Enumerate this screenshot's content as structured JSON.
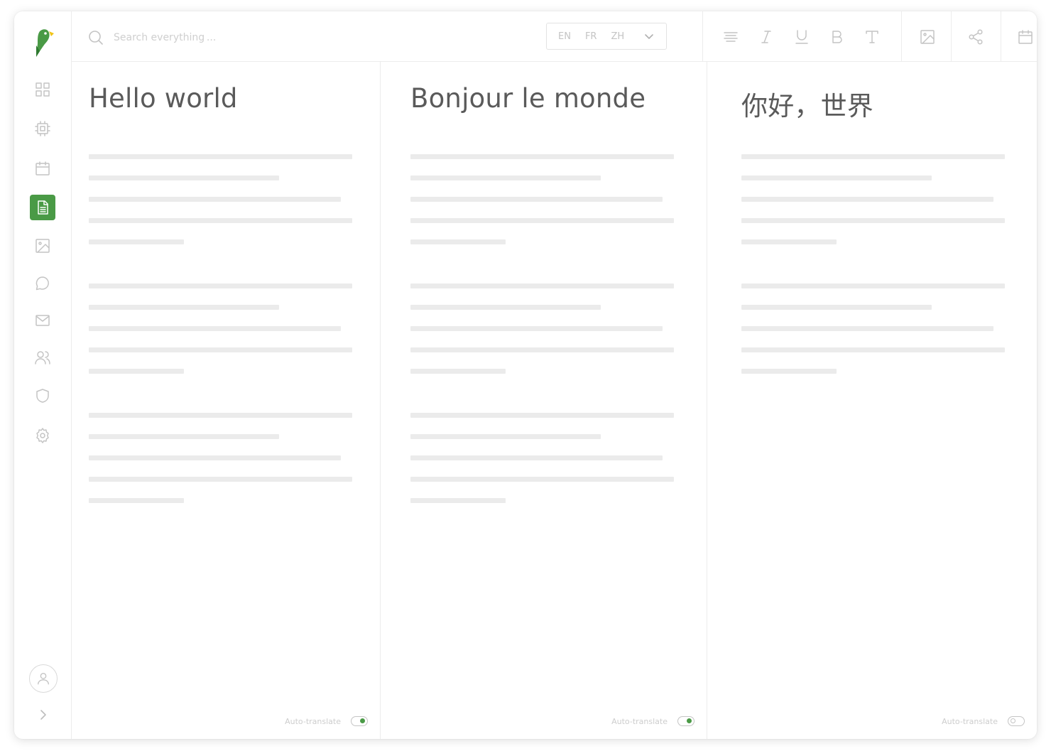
{
  "app": {
    "brand_colors": {
      "primary": "#4a9a46",
      "accent": "#f0c419"
    }
  },
  "sidebar": {
    "items": [
      {
        "name": "dashboard-grid-icon",
        "active": false
      },
      {
        "name": "chip-icon",
        "active": false
      },
      {
        "name": "calendar-icon",
        "active": false
      },
      {
        "name": "document-icon",
        "active": true
      },
      {
        "name": "image-icon",
        "active": false
      },
      {
        "name": "chat-icon",
        "active": false
      },
      {
        "name": "mail-icon",
        "active": false
      },
      {
        "name": "users-icon",
        "active": false
      },
      {
        "name": "shield-icon",
        "active": false
      },
      {
        "name": "gear-icon",
        "active": false
      }
    ],
    "bottom": [
      "user-avatar-icon",
      "chevron-right-icon"
    ]
  },
  "search": {
    "placeholder": "Search everything ...",
    "value": ""
  },
  "languages": {
    "options": [
      "EN",
      "FR",
      "ZH"
    ]
  },
  "toolbar": {
    "format_tools": [
      "align-text-icon",
      "italic-icon",
      "underline-icon",
      "bold-icon",
      "text-style-icon"
    ],
    "actions": [
      "insert-image-icon",
      "share-icon",
      "calendar-icon"
    ]
  },
  "columns": [
    {
      "lang": "EN",
      "title": "Hello world",
      "footer_label": "Auto-translate",
      "auto_translate": true,
      "paragraphs": 3
    },
    {
      "lang": "FR",
      "title": "Bonjour le monde",
      "footer_label": "Auto-translate",
      "auto_translate": true,
      "paragraphs": 3
    },
    {
      "lang": "ZH",
      "title": "你好，世界",
      "footer_label": "Auto-translate",
      "auto_translate": false,
      "paragraphs": 2
    }
  ]
}
